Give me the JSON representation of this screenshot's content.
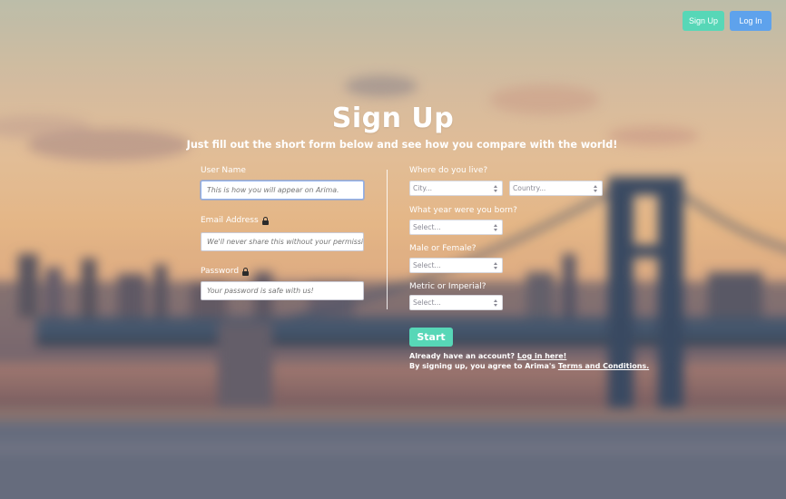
{
  "nav": {
    "signup_label": "Sign Up",
    "login_label": "Log In"
  },
  "header": {
    "title": "Sign Up",
    "subtitle": "Just fill out the short form below and see how you compare with the world!"
  },
  "left_form": {
    "username": {
      "label": "User Name",
      "placeholder": "This is how you will appear on Arima."
    },
    "email": {
      "label": "Email Address",
      "placeholder": "We'll never share this without your permission."
    },
    "password": {
      "label": "Password",
      "placeholder": "Your password is safe with us!"
    }
  },
  "right_form": {
    "location": {
      "label": "Where do you live?",
      "city": "City...",
      "country": "Country..."
    },
    "birth_year": {
      "label": "What year were you born?",
      "value": "Select..."
    },
    "gender": {
      "label": "Male or Female?",
      "value": "Select..."
    },
    "units": {
      "label": "Metric or Imperial?",
      "value": "Select..."
    }
  },
  "actions": {
    "start_label": "Start",
    "account_text": "Already have an account?",
    "login_link": "Log in here!",
    "terms_text": "By signing up, you agree to Arima's",
    "terms_link": "Terms and Conditions."
  },
  "colors": {
    "teal": "#57d7b7",
    "blue": "#5ea2ec"
  }
}
